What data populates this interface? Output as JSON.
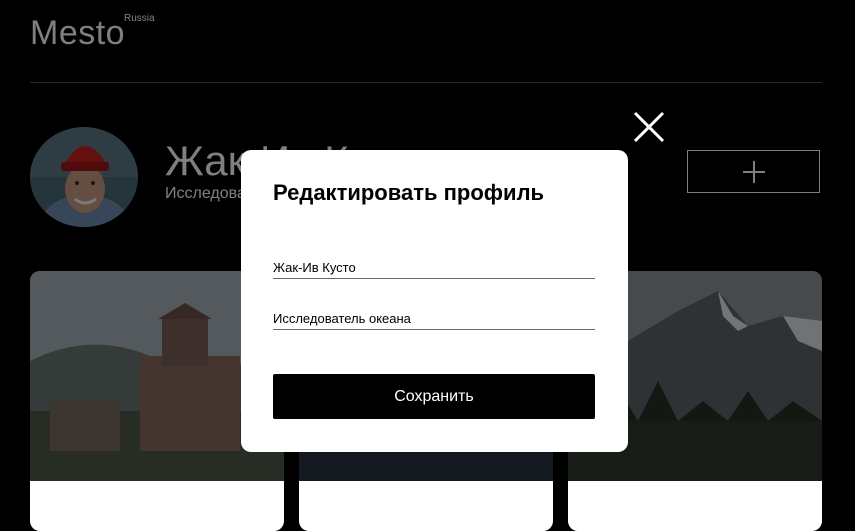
{
  "header": {
    "logo": "Mesto",
    "logo_suffix": "Russia"
  },
  "profile": {
    "name": "Жак-Ив Кусто",
    "about": "Исследователь океана"
  },
  "popup": {
    "title": "Редактировать профиль",
    "name_value": "Жак-Ив Кусто",
    "about_value": "Исследователь океана",
    "save_label": "Сохранить"
  },
  "icons": {
    "close": "close-icon",
    "add": "plus-icon",
    "edit": "pencil-icon"
  },
  "colors": {
    "background": "#000000",
    "popup": "#ffffff",
    "divider": "#545454"
  }
}
